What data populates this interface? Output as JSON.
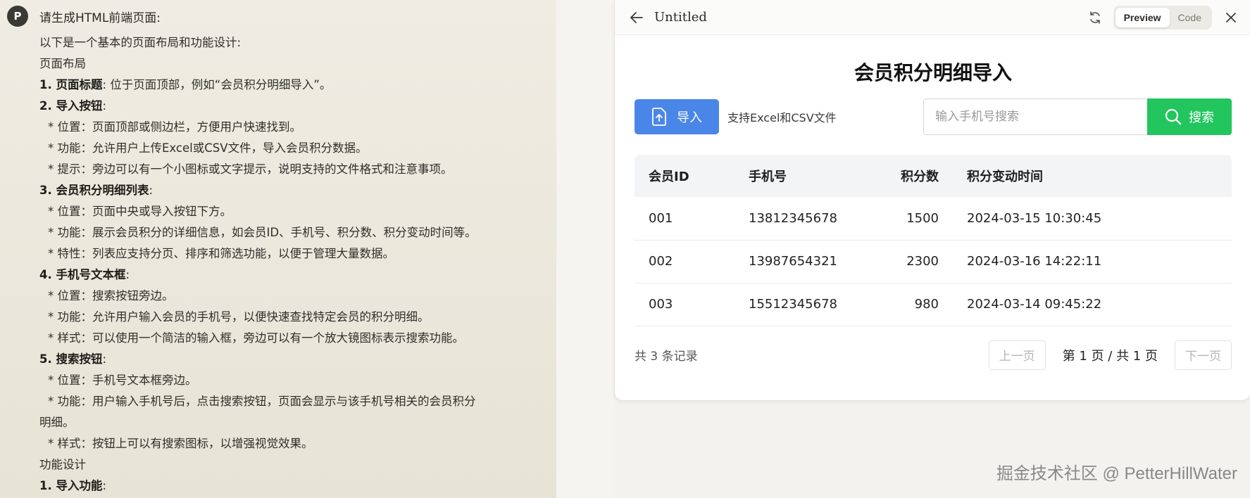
{
  "chat": {
    "avatar_letter": "P",
    "prompt": "请生成HTML前端页面:",
    "intro": "以下是一个基本的页面布局和功能设计:",
    "section_layout": "页面布局",
    "items": [
      {
        "title": "1. 页面标题",
        "text": ": 位于页面顶部，例如“会员积分明细导入”。"
      },
      {
        "title": "2. 导入按钮",
        "text": ":"
      },
      {
        "sub": "* 位置：页面顶部或侧边栏，方便用户快速找到。"
      },
      {
        "sub": "* 功能：允许用户上传Excel或CSV文件，导入会员积分数据。"
      },
      {
        "sub": "* 提示：旁边可以有一个小图标或文字提示，说明支持的文件格式和注意事项。"
      },
      {
        "title": "3. 会员积分明细列表",
        "text": ":"
      },
      {
        "sub": "* 位置：页面中央或导入按钮下方。"
      },
      {
        "sub": "* 功能：展示会员积分的详细信息，如会员ID、手机号、积分数、积分变动时间等。"
      },
      {
        "sub": "* 特性：列表应支持分页、排序和筛选功能，以便于管理大量数据。"
      },
      {
        "title": "4. 手机号文本框",
        "text": ":"
      },
      {
        "sub": "* 位置：搜索按钮旁边。"
      },
      {
        "sub": "* 功能：允许用户输入会员的手机号，以便快速查找特定会员的积分明细。"
      },
      {
        "sub": "* 样式：可以使用一个简洁的输入框，旁边可以有一个放大镜图标表示搜索功能。"
      },
      {
        "title": "5. 搜索按钮",
        "text": ":"
      },
      {
        "sub": "* 位置：手机号文本框旁边。"
      },
      {
        "sub": "* 功能：用户输入手机号后，点击搜索按钮，页面会显示与该手机号相关的会员积分"
      },
      {
        "plain": "明细。"
      },
      {
        "sub": "* 样式：按钮上可以有搜索图标，以增强视觉效果。"
      }
    ],
    "section_func": "功能设计",
    "func_item": "1. 导入功能",
    "func_item_suffix": ":"
  },
  "preview": {
    "title": "Untitled",
    "toggle_preview": "Preview",
    "toggle_code": "Code",
    "app_title": "会员积分明细导入",
    "import_label": "导入",
    "import_hint": "支持Excel和CSV文件",
    "search_placeholder": "输入手机号搜索",
    "search_label": "搜索",
    "columns": [
      "会员ID",
      "手机号",
      "积分数",
      "积分变动时间"
    ],
    "rows": [
      [
        "001",
        "13812345678",
        "1500",
        "2024-03-15 10:30:45"
      ],
      [
        "002",
        "13987654321",
        "2300",
        "2024-03-16 14:22:11"
      ],
      [
        "003",
        "15512345678",
        "980",
        "2024-03-14 09:45:22"
      ]
    ],
    "total_text": "共 3 条记录",
    "prev_label": "上一页",
    "page_info": "第 1 页 / 共 1 页",
    "next_label": "下一页"
  },
  "watermark": "掘金技术社区 @ PetterHillWater",
  "colors": {
    "import_button": "#4a86e8",
    "search_button": "#22c55e",
    "table_header_bg": "#f3f4f6"
  }
}
